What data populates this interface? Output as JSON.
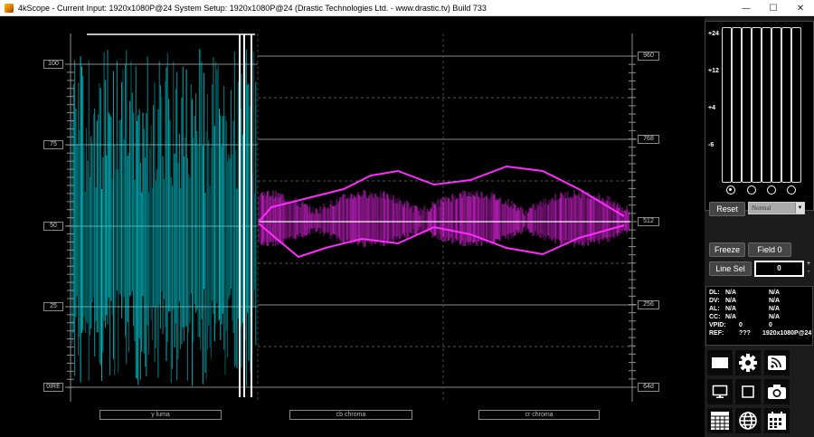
{
  "window": {
    "title": "4kScope -   Current Input: 1920x1080P@24   System Setup: 1920x1080P@24     (Drastic Technologies Ltd. - www.drastic.tv) Build 733",
    "minimize": "—",
    "maximize": "☐",
    "close": "✕"
  },
  "scope": {
    "left_ticks": [
      "100",
      "75",
      "50",
      "25",
      "0IRE"
    ],
    "right_ticks": [
      "960",
      "768",
      "512",
      "256",
      "64d"
    ],
    "channels": [
      "y luma",
      "cb chroma",
      "cr chroma"
    ],
    "colors": {
      "luma": "#00e5ef",
      "chroma": "#ff2bff",
      "graticule": "#8c8c8c"
    }
  },
  "meters": {
    "db_labels": [
      "+24",
      "+12",
      "+4",
      "-6"
    ],
    "count": 4,
    "selected_index": 0
  },
  "controls": {
    "reset": "Reset",
    "mode": "Normal",
    "freeze": "Freeze",
    "field": "Field 0",
    "line_sel": "Line Sel",
    "line_value": "0",
    "spin_up": "+",
    "spin_down": "-"
  },
  "info": {
    "rows": [
      {
        "k": "DL:",
        "a": "N/A",
        "b": "N/A"
      },
      {
        "k": "DV:",
        "a": "N/A",
        "b": "N/A"
      },
      {
        "k": "AL:",
        "a": "N/A",
        "b": "N/A"
      },
      {
        "k": "CC:",
        "a": "N/A",
        "b": "N/A"
      },
      {
        "k": "VPID:",
        "a": "0",
        "b": "0"
      },
      {
        "k": "REF:",
        "a": "???",
        "b": "1920x1080P@24"
      }
    ]
  },
  "tools": [
    "monitor-icon",
    "settings-icon",
    "rss-icon",
    "display-icon",
    "square-icon",
    "camera-icon",
    "grid-icon",
    "globe-icon",
    "calendar-icon"
  ]
}
